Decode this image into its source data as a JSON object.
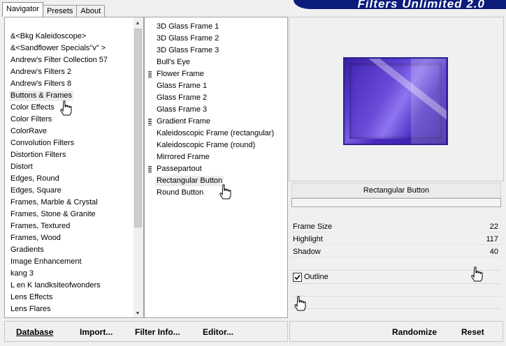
{
  "banner": {
    "title": "Filters Unlimited 2.0"
  },
  "tabs": [
    "Navigator",
    "Presets",
    "About"
  ],
  "categories": [
    "&<Bkg Kaleidoscope>",
    "&<Sandflower Specials\"v\" >",
    "Andrew's Filter Collection 57",
    "Andrew's Filters 2",
    "Andrew's Filters 8",
    "Buttons & Frames",
    "Color Effects",
    "Color Filters",
    "ColorRave",
    "Convolution Filters",
    "Distortion Filters",
    "Distort",
    "Edges, Round",
    "Edges, Square",
    "Frames, Marble & Crystal",
    "Frames, Stone & Granite",
    "Frames, Textured",
    "Frames, Wood",
    "Gradients",
    "Image Enhancement",
    "kang 3",
    "L en K landksiteofwonders",
    "Lens Effects",
    "Lens Flares"
  ],
  "selected_category": "Buttons & Frames",
  "filters": [
    {
      "label": "3D Glass Frame 1",
      "marked": false
    },
    {
      "label": "3D Glass Frame 2",
      "marked": false
    },
    {
      "label": "3D Glass Frame 3",
      "marked": false
    },
    {
      "label": "Bull's Eye",
      "marked": false
    },
    {
      "label": "Flower Frame",
      "marked": true
    },
    {
      "label": "Glass Frame 1",
      "marked": false
    },
    {
      "label": "Glass Frame 2",
      "marked": false
    },
    {
      "label": "Glass Frame 3",
      "marked": false
    },
    {
      "label": "Gradient Frame",
      "marked": true
    },
    {
      "label": "Kaleidoscopic Frame (rectangular)",
      "marked": false
    },
    {
      "label": "Kaleidoscopic Frame (round)",
      "marked": false
    },
    {
      "label": "Mirrored Frame",
      "marked": false
    },
    {
      "label": "Passepartout",
      "marked": true
    },
    {
      "label": "Rectangular Button",
      "marked": false
    },
    {
      "label": "Round Button",
      "marked": false
    }
  ],
  "selected_filter": "Rectangular Button",
  "filter_title": "Rectangular Button",
  "params": [
    {
      "label": "Frame Size",
      "value": "22"
    },
    {
      "label": "Highlight",
      "value": "117"
    },
    {
      "label": "Shadow",
      "value": "40"
    }
  ],
  "outline": {
    "label": "Outline",
    "checked": true
  },
  "bottom_left": {
    "database": "Database",
    "import": "Import...",
    "filter_info": "Filter Info...",
    "editor": "Editor..."
  },
  "bottom_right": {
    "randomize": "Randomize",
    "reset": "Reset"
  },
  "icons": {
    "hand_cursor": "hand-pointer-icon",
    "checkbox_check": "checkmark-icon",
    "scroll_up": "triangle-up-icon",
    "scroll_down": "triangle-down-icon",
    "marker": "striped-marker-icon"
  }
}
